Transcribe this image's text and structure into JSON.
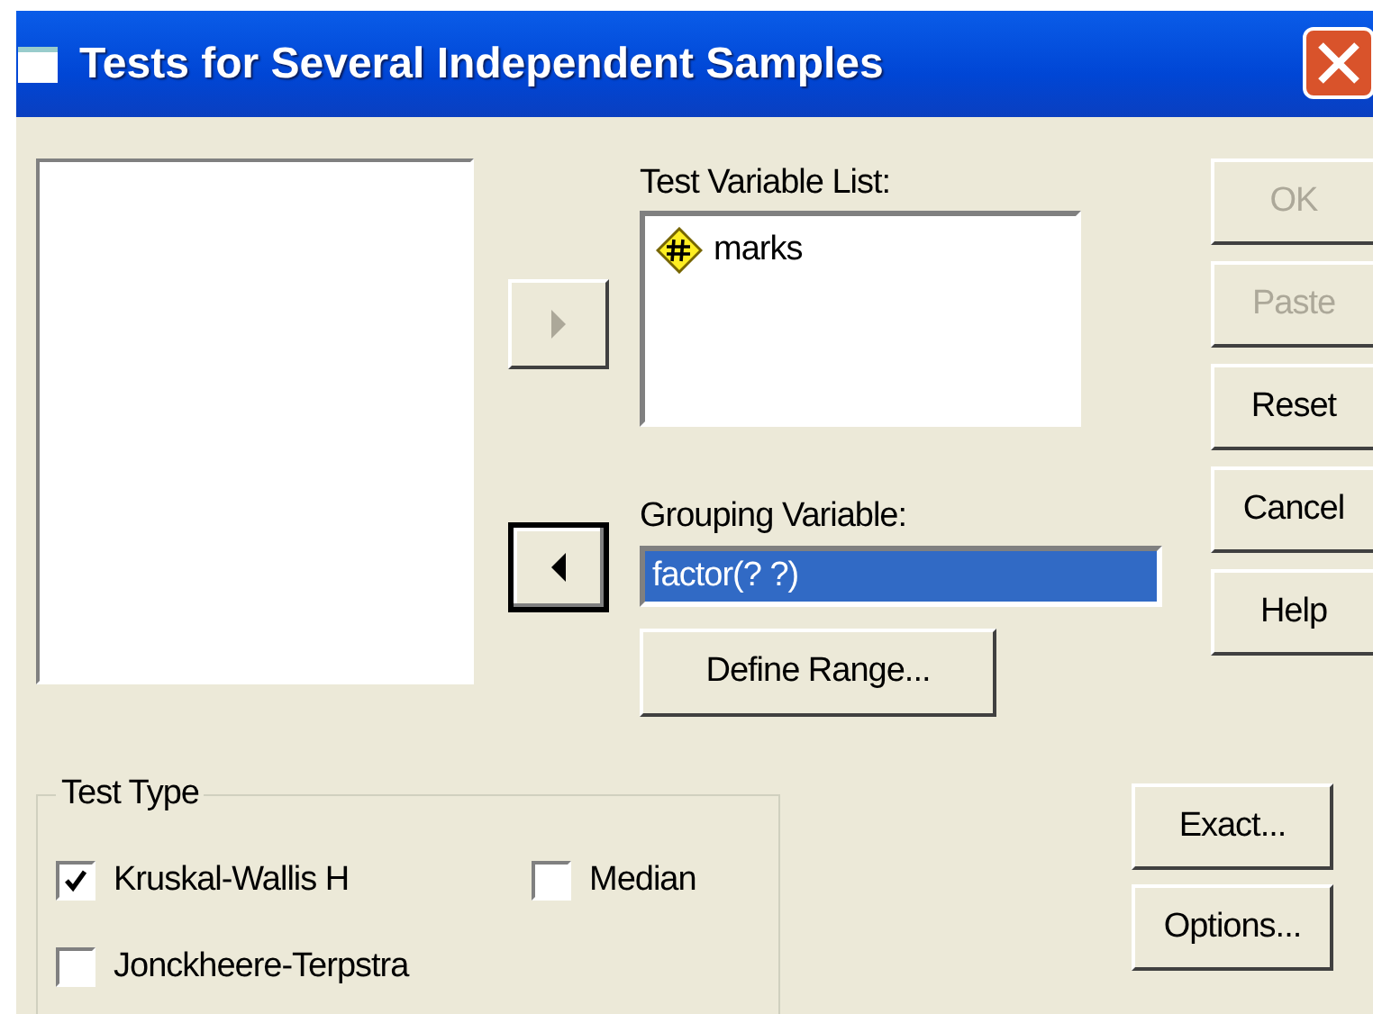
{
  "window": {
    "title": "Tests for Several Independent Samples"
  },
  "arrow_buttons": [
    {
      "kind": "right",
      "disabled": true,
      "focused": false
    },
    {
      "kind": "left",
      "disabled": false,
      "focused": true
    }
  ],
  "test_variable_list": {
    "label": "Test Variable List:",
    "items": [
      {
        "name": "marks"
      }
    ]
  },
  "grouping_variable": {
    "label": "Grouping Variable:",
    "value": "factor(? ?)",
    "selected": true
  },
  "define_range_button": "Define Range...",
  "buttons": [
    {
      "label": "OK",
      "disabled": true
    },
    {
      "label": "Paste",
      "disabled": true
    },
    {
      "label": "Reset",
      "disabled": false
    },
    {
      "label": "Cancel",
      "disabled": false
    },
    {
      "label": "Help",
      "disabled": false
    }
  ],
  "test_type": {
    "title": "Test Type",
    "options": [
      {
        "label": "Kruskal-Wallis H",
        "checked": true
      },
      {
        "label": "Median",
        "checked": false
      },
      {
        "label": "Jonckheere-Terpstra",
        "checked": false
      }
    ]
  },
  "side_buttons": [
    {
      "label": "Exact...",
      "disabled": false
    },
    {
      "label": "Options...",
      "disabled": false
    }
  ]
}
